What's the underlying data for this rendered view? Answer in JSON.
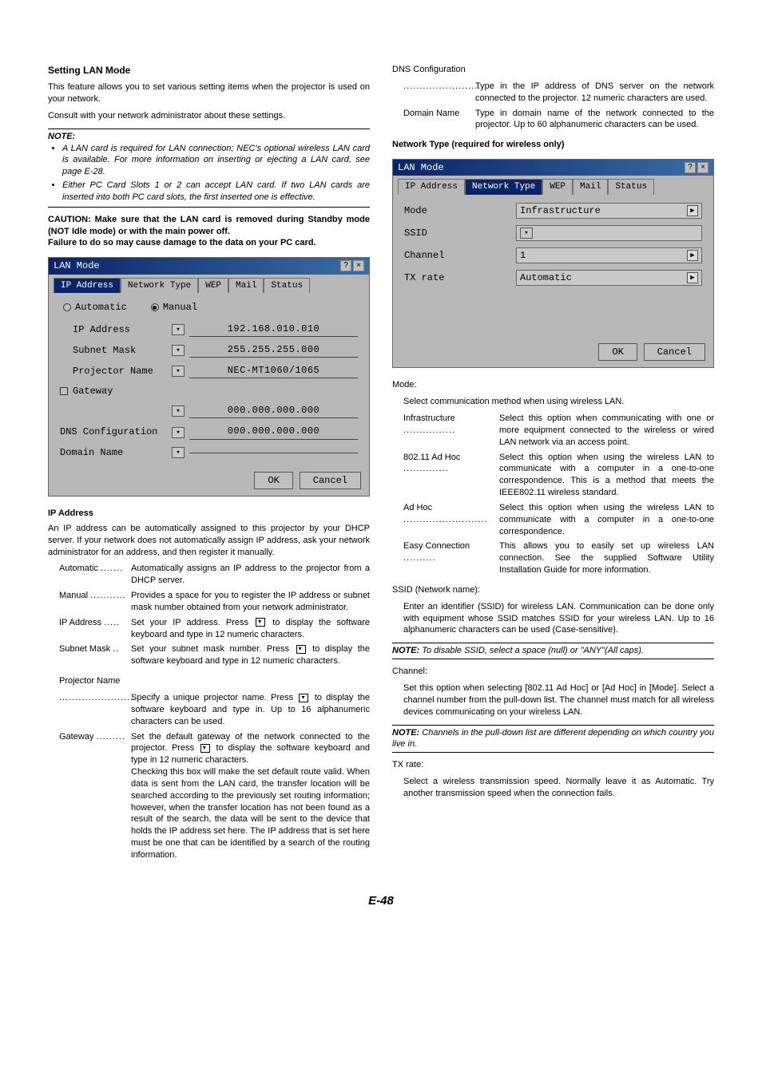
{
  "pageNumber": "E-48",
  "left": {
    "heading": "Setting LAN Mode",
    "intro1": "This feature allows you to set various setting items when the projector is used on your network.",
    "intro2": "Consult with your network administrator about these settings.",
    "noteLabel": "NOTE:",
    "noteBullets": [
      "A LAN card is required for LAN connection; NEC's optional wireless LAN card is available. For more information on inserting or ejecting a LAN card, see page E-28.",
      "Either PC Card Slots 1 or 2 can accept LAN card. If two LAN cards are inserted into both PC card slots, the first inserted one is effective."
    ],
    "caution": "CAUTION: Make sure that the LAN card is removed during Standby mode (NOT Idle mode) or with the main power off.\nFailure to do so may cause damage to the data on your PC card.",
    "dialog1": {
      "title": "LAN Mode",
      "tabs": [
        "IP Address",
        "Network Type",
        "WEP",
        "Mail",
        "Status"
      ],
      "radioAuto": "Automatic",
      "radioManual": "Manual",
      "rows": {
        "ip_label": "IP Address",
        "ip_val": "192.168.010.010",
        "subnet_label": "Subnet Mask",
        "subnet_val": "255.255.255.000",
        "proj_label": "Projector Name",
        "proj_val": "NEC-MT1060/1065",
        "gw_label": "Gateway",
        "gw_val": "000.000.000.000",
        "dns_label": "DNS Configuration",
        "dns_val": "000.000.000.000",
        "domain_label": "Domain Name",
        "domain_val": ""
      },
      "ok": "OK",
      "cancel": "Cancel"
    },
    "ipAddress": {
      "heading": "IP Address",
      "intro": "An IP address can be automatically assigned to this projector by your DHCP server. If your network does not automatically assign IP address, ask your network administrator for an address, and then register it manually.",
      "defs": [
        {
          "term": "Automatic",
          "dots": ".......",
          "desc": "Automatically assigns an IP address to the projector from a DHCP server."
        },
        {
          "term": "Manual",
          "dots": "...........",
          "desc": "Provides a space for you to register the IP address or subnet mask number obtained from your network administrator."
        },
        {
          "term": "IP Address",
          "dots": ".....",
          "desc_pre": "Set your IP address. Press ",
          "desc_post": " to display the software keyboard and type in 12 numeric characters."
        },
        {
          "term": "Subnet Mask",
          "dots": "..",
          "desc_pre": "Set your subnet mask number. Press ",
          "desc_post": " to display the software keyboard and type in 12 numeric characters."
        }
      ],
      "projNameLabel": "Projector Name",
      "projName_dots": ".......................",
      "projName_pre": "Specify a unique projector name. Press ",
      "projName_post": " to display the software keyboard and type in. Up to 16 alphanumeric characters can be used.",
      "gateway_term": "Gateway",
      "gateway_dots": ".........",
      "gateway_pre": "Set the default gateway of the network connected to the projector. Press ",
      "gateway_post": " to display the software keyboard and type in 12 numeric characters.\nChecking this box will make the set default route valid. When data is sent from the LAN card, the transfer location will be searched according to the previously set routing information; however, when the transfer location has not been found as a result of the search, the data will be sent to the device that holds the IP address set here. The IP address that is set here must be one that can be identified by a search of the routing information."
    }
  },
  "right": {
    "dnsConfigLabel": "DNS Configuration",
    "dnsDots": "........................",
    "dnsDesc": "Type in the IP address of DNS server on the network connected to the projector. 12 numeric characters are used.",
    "domainTerm": "Domain Name",
    "domainDesc": "Type in domain name of the network connected to the projector. Up to 60 alphanumeric characters can be used.",
    "networkTypeHeading": "Network Type (required for wireless only)",
    "dialog2": {
      "title": "LAN Mode",
      "tabs": [
        "IP Address",
        "Network Type",
        "WEP",
        "Mail",
        "Status"
      ],
      "mode_label": "Mode",
      "mode_val": "Infrastructure",
      "ssid_label": "SSID",
      "ssid_val": "",
      "channel_label": "Channel",
      "channel_val": "1",
      "tx_label": "TX rate",
      "tx_val": "Automatic",
      "ok": "OK",
      "cancel": "Cancel"
    },
    "modeHeading": "Mode:",
    "modeIntro": "Select communication method when using wireless LAN.",
    "modeDefs": [
      {
        "term": "Infrastructure",
        "dots": "................",
        "desc": "Select this option when communicating with one or more equipment connected to the wireless or wired LAN network via an access point."
      },
      {
        "term": "802.11 Ad Hoc",
        "dots": "..............",
        "desc": "Select this option when using the wireless LAN to communicate with a computer in a one-to-one correspondence. This is a method that meets the IEEE802.11 wireless standard."
      },
      {
        "term": "Ad Hoc",
        "dots": "..........................",
        "desc": "Select this option when using the wireless LAN to communicate with a computer in a one-to-one correspondence."
      },
      {
        "term": "Easy Connection",
        "dots": "..........",
        "desc": "This allows you to easily set up wireless LAN connection. See the supplied Software Utility Installation Guide for more information."
      }
    ],
    "ssidHeading": "SSID (Network name):",
    "ssidDesc": "Enter an identifier (SSID) for wireless LAN. Communication can be done only with equipment whose SSID matches SSID for your wireless LAN. Up to 16 alphanumeric characters can be used (Case-sensitive).",
    "ssidNote": "To disable SSID, select a space (null) or \"ANY\"(All caps).",
    "channelHeading": "Channel:",
    "channelDesc": "Set this option when selecting [802.11 Ad Hoc] or [Ad Hoc] in [Mode]. Select a channel number from the pull-down list. The channel must match for all wireless devices communicating on your wireless LAN.",
    "channelNote": "Channels in the pull-down list are different depending on which country you live in.",
    "txHeading": "TX rate:",
    "txDesc": "Select a wireless transmission speed. Normally leave it as Automatic. Try another transmission speed when the connection fails."
  }
}
